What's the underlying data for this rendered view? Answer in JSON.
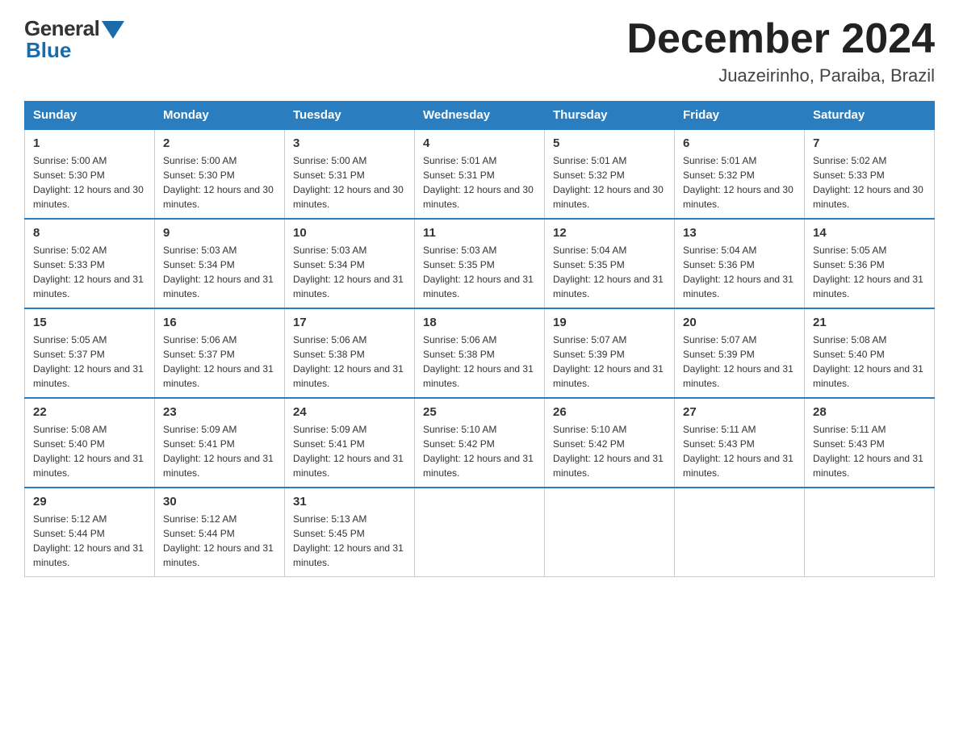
{
  "logo": {
    "general": "General",
    "blue": "Blue"
  },
  "header": {
    "month": "December 2024",
    "location": "Juazeirinho, Paraiba, Brazil"
  },
  "days_of_week": [
    "Sunday",
    "Monday",
    "Tuesday",
    "Wednesday",
    "Thursday",
    "Friday",
    "Saturday"
  ],
  "weeks": [
    [
      {
        "day": 1,
        "sunrise": "5:00 AM",
        "sunset": "5:30 PM",
        "daylight": "12 hours and 30 minutes."
      },
      {
        "day": 2,
        "sunrise": "5:00 AM",
        "sunset": "5:30 PM",
        "daylight": "12 hours and 30 minutes."
      },
      {
        "day": 3,
        "sunrise": "5:00 AM",
        "sunset": "5:31 PM",
        "daylight": "12 hours and 30 minutes."
      },
      {
        "day": 4,
        "sunrise": "5:01 AM",
        "sunset": "5:31 PM",
        "daylight": "12 hours and 30 minutes."
      },
      {
        "day": 5,
        "sunrise": "5:01 AM",
        "sunset": "5:32 PM",
        "daylight": "12 hours and 30 minutes."
      },
      {
        "day": 6,
        "sunrise": "5:01 AM",
        "sunset": "5:32 PM",
        "daylight": "12 hours and 30 minutes."
      },
      {
        "day": 7,
        "sunrise": "5:02 AM",
        "sunset": "5:33 PM",
        "daylight": "12 hours and 30 minutes."
      }
    ],
    [
      {
        "day": 8,
        "sunrise": "5:02 AM",
        "sunset": "5:33 PM",
        "daylight": "12 hours and 31 minutes."
      },
      {
        "day": 9,
        "sunrise": "5:03 AM",
        "sunset": "5:34 PM",
        "daylight": "12 hours and 31 minutes."
      },
      {
        "day": 10,
        "sunrise": "5:03 AM",
        "sunset": "5:34 PM",
        "daylight": "12 hours and 31 minutes."
      },
      {
        "day": 11,
        "sunrise": "5:03 AM",
        "sunset": "5:35 PM",
        "daylight": "12 hours and 31 minutes."
      },
      {
        "day": 12,
        "sunrise": "5:04 AM",
        "sunset": "5:35 PM",
        "daylight": "12 hours and 31 minutes."
      },
      {
        "day": 13,
        "sunrise": "5:04 AM",
        "sunset": "5:36 PM",
        "daylight": "12 hours and 31 minutes."
      },
      {
        "day": 14,
        "sunrise": "5:05 AM",
        "sunset": "5:36 PM",
        "daylight": "12 hours and 31 minutes."
      }
    ],
    [
      {
        "day": 15,
        "sunrise": "5:05 AM",
        "sunset": "5:37 PM",
        "daylight": "12 hours and 31 minutes."
      },
      {
        "day": 16,
        "sunrise": "5:06 AM",
        "sunset": "5:37 PM",
        "daylight": "12 hours and 31 minutes."
      },
      {
        "day": 17,
        "sunrise": "5:06 AM",
        "sunset": "5:38 PM",
        "daylight": "12 hours and 31 minutes."
      },
      {
        "day": 18,
        "sunrise": "5:06 AM",
        "sunset": "5:38 PM",
        "daylight": "12 hours and 31 minutes."
      },
      {
        "day": 19,
        "sunrise": "5:07 AM",
        "sunset": "5:39 PM",
        "daylight": "12 hours and 31 minutes."
      },
      {
        "day": 20,
        "sunrise": "5:07 AM",
        "sunset": "5:39 PM",
        "daylight": "12 hours and 31 minutes."
      },
      {
        "day": 21,
        "sunrise": "5:08 AM",
        "sunset": "5:40 PM",
        "daylight": "12 hours and 31 minutes."
      }
    ],
    [
      {
        "day": 22,
        "sunrise": "5:08 AM",
        "sunset": "5:40 PM",
        "daylight": "12 hours and 31 minutes."
      },
      {
        "day": 23,
        "sunrise": "5:09 AM",
        "sunset": "5:41 PM",
        "daylight": "12 hours and 31 minutes."
      },
      {
        "day": 24,
        "sunrise": "5:09 AM",
        "sunset": "5:41 PM",
        "daylight": "12 hours and 31 minutes."
      },
      {
        "day": 25,
        "sunrise": "5:10 AM",
        "sunset": "5:42 PM",
        "daylight": "12 hours and 31 minutes."
      },
      {
        "day": 26,
        "sunrise": "5:10 AM",
        "sunset": "5:42 PM",
        "daylight": "12 hours and 31 minutes."
      },
      {
        "day": 27,
        "sunrise": "5:11 AM",
        "sunset": "5:43 PM",
        "daylight": "12 hours and 31 minutes."
      },
      {
        "day": 28,
        "sunrise": "5:11 AM",
        "sunset": "5:43 PM",
        "daylight": "12 hours and 31 minutes."
      }
    ],
    [
      {
        "day": 29,
        "sunrise": "5:12 AM",
        "sunset": "5:44 PM",
        "daylight": "12 hours and 31 minutes."
      },
      {
        "day": 30,
        "sunrise": "5:12 AM",
        "sunset": "5:44 PM",
        "daylight": "12 hours and 31 minutes."
      },
      {
        "day": 31,
        "sunrise": "5:13 AM",
        "sunset": "5:45 PM",
        "daylight": "12 hours and 31 minutes."
      },
      null,
      null,
      null,
      null
    ]
  ]
}
